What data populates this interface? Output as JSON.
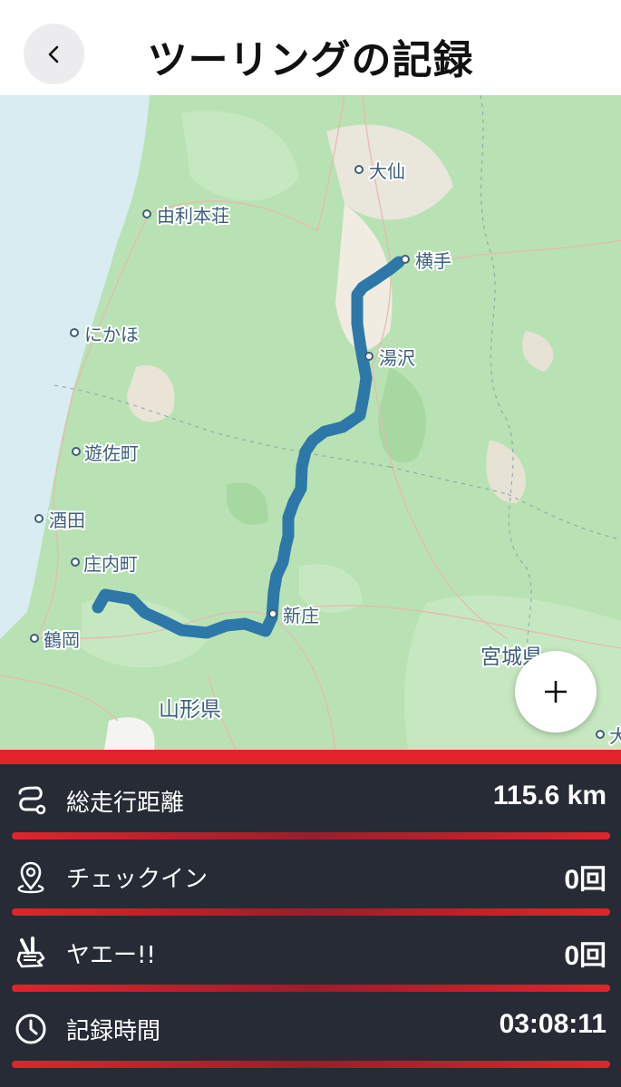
{
  "header": {
    "title": "ツーリングの記録",
    "back_icon": "chevron-left-icon"
  },
  "map": {
    "cities": [
      "大仙",
      "由利本荘",
      "横手",
      "にかほ",
      "湯沢",
      "遊佐町",
      "酒田",
      "庄内町",
      "新庄",
      "鶴岡"
    ],
    "prefectures": [
      "山形県",
      "宮城県"
    ],
    "partial_city": "大",
    "route_color": "#2d78a8",
    "zoom_icon": "plus-icon"
  },
  "stats": {
    "accent_color": "#e3232a",
    "rows": [
      {
        "icon": "route-icon",
        "label": "総走行距離",
        "value": "115.6 km"
      },
      {
        "icon": "location-pin-icon",
        "label": "チェックイン",
        "value": "0回"
      },
      {
        "icon": "peace-hand-icon",
        "label": "ヤエー!!",
        "value": "0回"
      },
      {
        "icon": "clock-icon",
        "label": "記録時間",
        "value": "03:08:11"
      }
    ]
  }
}
